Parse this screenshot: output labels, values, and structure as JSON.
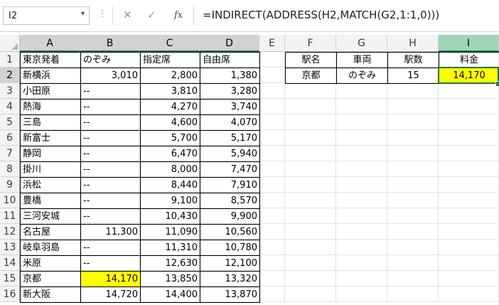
{
  "formula_bar": {
    "name_box": "I2",
    "formula": "=INDIRECT(ADDRESS(H2,MATCH(G2,1:1,0)))"
  },
  "icons": {
    "name_box_dropdown": "chevron-down-icon",
    "more": "vertical-dots-icon",
    "cancel": "close-icon",
    "enter": "check-icon",
    "function": "fx-icon"
  },
  "columns": [
    "A",
    "B",
    "C",
    "D",
    "E",
    "F",
    "G",
    "H",
    "I"
  ],
  "rows": [
    "1",
    "2",
    "3",
    "4",
    "5",
    "6",
    "7",
    "8",
    "9",
    "10",
    "11",
    "12",
    "13",
    "14",
    "15",
    "16"
  ],
  "fare_table": {
    "headers": [
      "東京発着",
      "のぞみ",
      "指定席",
      "自由席"
    ],
    "rows": [
      [
        "新横浜",
        "3,010",
        "2,800",
        "1,380"
      ],
      [
        "小田原",
        "--",
        "3,810",
        "3,280"
      ],
      [
        "熱海",
        "--",
        "4,270",
        "3,740"
      ],
      [
        "三島",
        "--",
        "4,600",
        "4,070"
      ],
      [
        "新富士",
        "--",
        "5,700",
        "5,170"
      ],
      [
        "静岡",
        "--",
        "6,470",
        "5,940"
      ],
      [
        "掛川",
        "--",
        "8,000",
        "7,470"
      ],
      [
        "浜松",
        "--",
        "8,440",
        "7,910"
      ],
      [
        "豊橋",
        "--",
        "9,100",
        "8,570"
      ],
      [
        "三河安城",
        "--",
        "10,430",
        "9,900"
      ],
      [
        "名古屋",
        "11,300",
        "11,090",
        "10,560"
      ],
      [
        "岐阜羽島",
        "--",
        "11,310",
        "10,780"
      ],
      [
        "米原",
        "--",
        "12,630",
        "12,100"
      ],
      [
        "京都",
        "14,170",
        "13,850",
        "13,320"
      ],
      [
        "新大阪",
        "14,720",
        "14,400",
        "13,870"
      ]
    ]
  },
  "lookup_table": {
    "headers": [
      "駅名",
      "車両",
      "駅数",
      "料金"
    ],
    "row": [
      "京都",
      "のぞみ",
      "15",
      "14,170"
    ]
  },
  "colors": {
    "highlight": "#ffff00",
    "selection": "#217346",
    "selected_header": "#9fd5b7"
  }
}
